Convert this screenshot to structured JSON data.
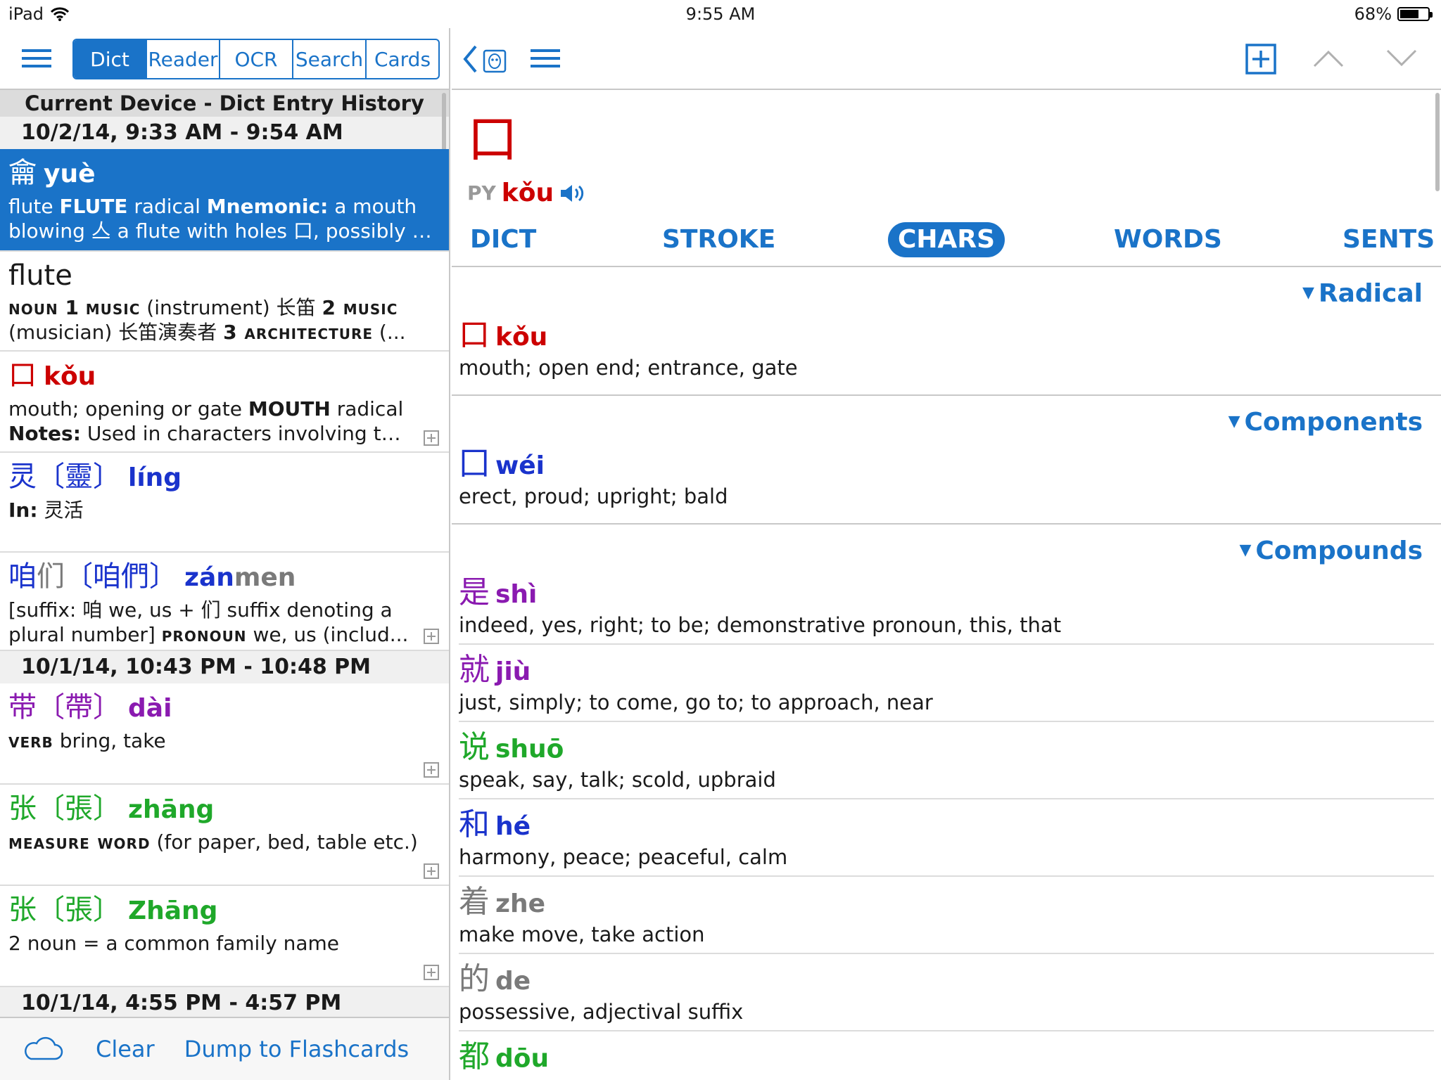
{
  "status": {
    "device": "iPad",
    "time": "9:55 AM",
    "battery": "68%",
    "battery_level": 0.68
  },
  "left_tabs": [
    "Dict",
    "Reader",
    "OCR",
    "Search",
    "Cards"
  ],
  "history": {
    "title": "Current Device - Dict Entry History",
    "session1": "10/2/14, 9:33 AM - 9:54 AM",
    "session2": "10/1/14, 10:43 PM - 10:48 PM",
    "session3": "10/1/14, 4:55 PM - 4:57 PM",
    "e1": {
      "hz": "龠",
      "py": "yuè",
      "l1a": "flute ",
      "l1b": "FLUTE",
      "l1c": " radical ",
      "l1d": "Mnemonic:",
      "l1e": " a mouth",
      "l2": "blowing 亼 a flute with holes 口, possibly pa..."
    },
    "e2": {
      "hz": "flute",
      "l1a": "noun",
      "l1b": " 1 ",
      "l1c": "music",
      "l1d": " (instrument) 长笛 ",
      "l1e": "2",
      "l1f": " music",
      "l2a": "(musician) 长笛演奏者 ",
      "l2b": "3",
      "l2c": " architecture",
      "l2d": " (..."
    },
    "e3": {
      "hz": "口",
      "py": "kǒu",
      "l1a": "mouth; opening or gate ",
      "l1b": "MOUTH",
      "l1c": " radical",
      "l2a": "Notes:",
      "l2b": " Used in characters involving thin..."
    },
    "e4": {
      "hz": "灵",
      "trad": "〔靈〕",
      "py": "líng",
      "l1a": "In:",
      "l1b": " 灵活"
    },
    "e5": {
      "hz1": "咱",
      "hz2": "们",
      "trad1": "〔咱",
      "trad2": "們〕",
      "py1": "zán",
      "py2": "men",
      "l1": "[suffix: 咱 we, us + 们 suffix denoting a",
      "l2a": "plural number] ",
      "l2b": "pronoun",
      "l2c": " we, us (includ..."
    },
    "e6": {
      "hz": "带",
      "trad": "〔帶〕",
      "py": "dài",
      "l1a": "verb",
      "l1b": " bring, take"
    },
    "e7": {
      "hz": "张",
      "trad": "〔張〕",
      "py": "zhāng",
      "l1a": "measure word",
      "l1b": " (for paper, bed, table etc.)"
    },
    "e8": {
      "hz": "张",
      "trad": "〔張〕",
      "py": "Zhāng",
      "l1": "2 noun = a common family name"
    }
  },
  "bottom": {
    "clear": "Clear",
    "dump": "Dump to Flashcards"
  },
  "entry": {
    "char": "口",
    "py_label": "PY",
    "py": "kǒu"
  },
  "tabs": [
    "DICT",
    "STROKE",
    "CHARS",
    "WORDS",
    "SENTS"
  ],
  "sections": {
    "radical": {
      "title": "Radical",
      "ch": "口",
      "py": "kǒu",
      "def": "mouth; open end; entrance, gate"
    },
    "components": {
      "title": "Components",
      "ch": "囗",
      "py": "wéi",
      "def": "erect, proud; upright; bald"
    },
    "compounds": {
      "title": "Compounds",
      "items": [
        {
          "ch": "是",
          "py": "shì",
          "def": "indeed, yes, right; to be; demonstrative pronoun, this, that",
          "color": "#8a1ab0"
        },
        {
          "ch": "就",
          "py": "jiù",
          "def": "just, simply; to come, go to; to approach, near",
          "color": "#8a1ab0"
        },
        {
          "ch": "说",
          "py": "shuō",
          "def": "speak, say, talk; scold, upbraid",
          "color": "#1fa82a"
        },
        {
          "ch": "和",
          "py": "hé",
          "def": "harmony, peace; peaceful, calm",
          "color": "#1a33cc"
        },
        {
          "ch": "着",
          "py": "zhe",
          "def": "make move, take action",
          "color": "#7a7a7a"
        },
        {
          "ch": "的",
          "py": "de",
          "def": "possessive, adjectival suffix",
          "color": "#7a7a7a"
        },
        {
          "ch": "都",
          "py": "dōu",
          "def": "",
          "color": "#1fa82a"
        }
      ]
    }
  }
}
